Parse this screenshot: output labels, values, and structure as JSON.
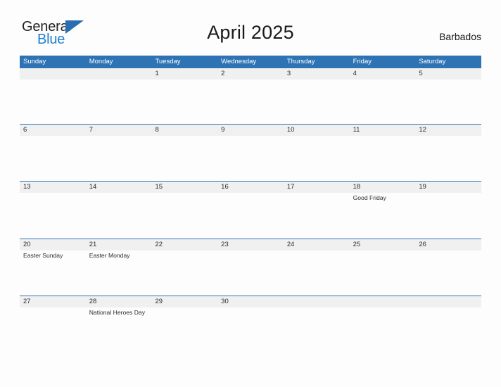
{
  "brand": {
    "name_top": "General",
    "name_bottom": "Blue",
    "flag_icon": "blue-triangle-flag-icon",
    "color_dark": "#231f20",
    "color_blue": "#1f7fd0"
  },
  "header": {
    "title": "April 2025",
    "region": "Barbados"
  },
  "theme": {
    "header_blue": "#2e74b5",
    "band_gray": "#f0f0f0",
    "page_background": "#fdfdfd",
    "text_dark": "#2b2b2b"
  },
  "calendar": {
    "weekdays": [
      "Sunday",
      "Monday",
      "Tuesday",
      "Wednesday",
      "Thursday",
      "Friday",
      "Saturday"
    ],
    "weeks": [
      {
        "days": [
          {
            "date": "",
            "event": ""
          },
          {
            "date": "",
            "event": ""
          },
          {
            "date": "1",
            "event": ""
          },
          {
            "date": "2",
            "event": ""
          },
          {
            "date": "3",
            "event": ""
          },
          {
            "date": "4",
            "event": ""
          },
          {
            "date": "5",
            "event": ""
          }
        ]
      },
      {
        "days": [
          {
            "date": "6",
            "event": ""
          },
          {
            "date": "7",
            "event": ""
          },
          {
            "date": "8",
            "event": ""
          },
          {
            "date": "9",
            "event": ""
          },
          {
            "date": "10",
            "event": ""
          },
          {
            "date": "11",
            "event": ""
          },
          {
            "date": "12",
            "event": ""
          }
        ]
      },
      {
        "days": [
          {
            "date": "13",
            "event": ""
          },
          {
            "date": "14",
            "event": ""
          },
          {
            "date": "15",
            "event": ""
          },
          {
            "date": "16",
            "event": ""
          },
          {
            "date": "17",
            "event": ""
          },
          {
            "date": "18",
            "event": "Good Friday"
          },
          {
            "date": "19",
            "event": ""
          }
        ]
      },
      {
        "days": [
          {
            "date": "20",
            "event": "Easter Sunday"
          },
          {
            "date": "21",
            "event": "Easter Monday"
          },
          {
            "date": "22",
            "event": ""
          },
          {
            "date": "23",
            "event": ""
          },
          {
            "date": "24",
            "event": ""
          },
          {
            "date": "25",
            "event": ""
          },
          {
            "date": "26",
            "event": ""
          }
        ]
      },
      {
        "days": [
          {
            "date": "27",
            "event": ""
          },
          {
            "date": "28",
            "event": "National Heroes Day"
          },
          {
            "date": "29",
            "event": ""
          },
          {
            "date": "30",
            "event": ""
          },
          {
            "date": "",
            "event": ""
          },
          {
            "date": "",
            "event": ""
          },
          {
            "date": "",
            "event": ""
          }
        ]
      }
    ]
  }
}
